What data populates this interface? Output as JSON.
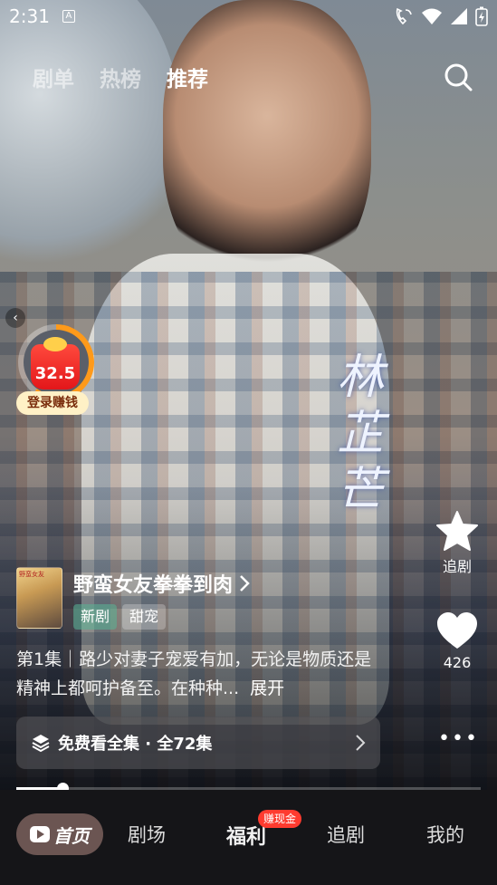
{
  "status_bar": {
    "time": "2:31",
    "app_indicator": "A",
    "icons": [
      "wifi-calling-icon",
      "wifi-icon",
      "signal-icon",
      "battery-charging-icon"
    ]
  },
  "top_tabs": [
    {
      "label": "剧单",
      "active": false
    },
    {
      "label": "热榜",
      "active": false
    },
    {
      "label": "推荐",
      "active": true
    }
  ],
  "search": {
    "icon": "search-icon"
  },
  "video": {
    "overlay_text": "林芷芒"
  },
  "reward_widget": {
    "amount": "32.5",
    "label": "登录赚钱",
    "progress": 0.6
  },
  "side_actions": {
    "follow_label": "追剧",
    "like_count": "426",
    "more_icon": "more-dots-icon"
  },
  "drama": {
    "cover_text": "野蛮女友",
    "title": "野蛮女友拳拳到肉",
    "tags": [
      "新剧",
      "甜宠"
    ],
    "description": "第1集｜路少对妻子宠爱有加，无论是物质还是精神上都呵护备至。在种种...",
    "expand_label": "展开"
  },
  "episodes_bar": {
    "label": "免费看全集 · 全72集"
  },
  "playback": {
    "progress": 0.1
  },
  "bottom_nav": {
    "home": "首页",
    "theater": "剧场",
    "welfare": "福利",
    "welfare_badge": "赚现金",
    "follow": "追剧",
    "mine": "我的"
  },
  "colors": {
    "accent_orange": "#ff9a1a",
    "badge_red": "#ff3b2f",
    "nav_bg": "#151518"
  }
}
